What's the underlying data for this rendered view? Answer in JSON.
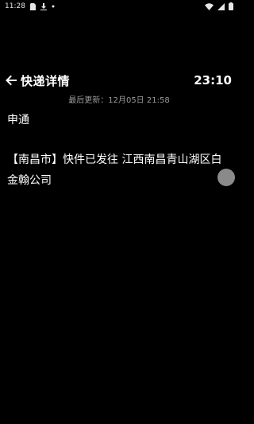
{
  "status_bar": {
    "time": "11:28",
    "left_icons": [
      "sim-card-icon",
      "download-icon",
      "notification-dot-icon"
    ],
    "right_icons": [
      "wifi-icon",
      "cellular-signal-icon",
      "battery-icon"
    ]
  },
  "header": {
    "back_icon": "arrow-left-icon",
    "title": "快递详情",
    "clock": "23:10"
  },
  "last_updated": "最后更新：12月05日 21:58",
  "carrier": "申通",
  "tracking_detail": "【南昌市】快件已发往 江西南昌青山湖区白金翰公司",
  "colors": {
    "background": "#000000",
    "text": "#ffffff",
    "muted": "#9a9a9a",
    "floating_ball": "#8a8a8a"
  }
}
